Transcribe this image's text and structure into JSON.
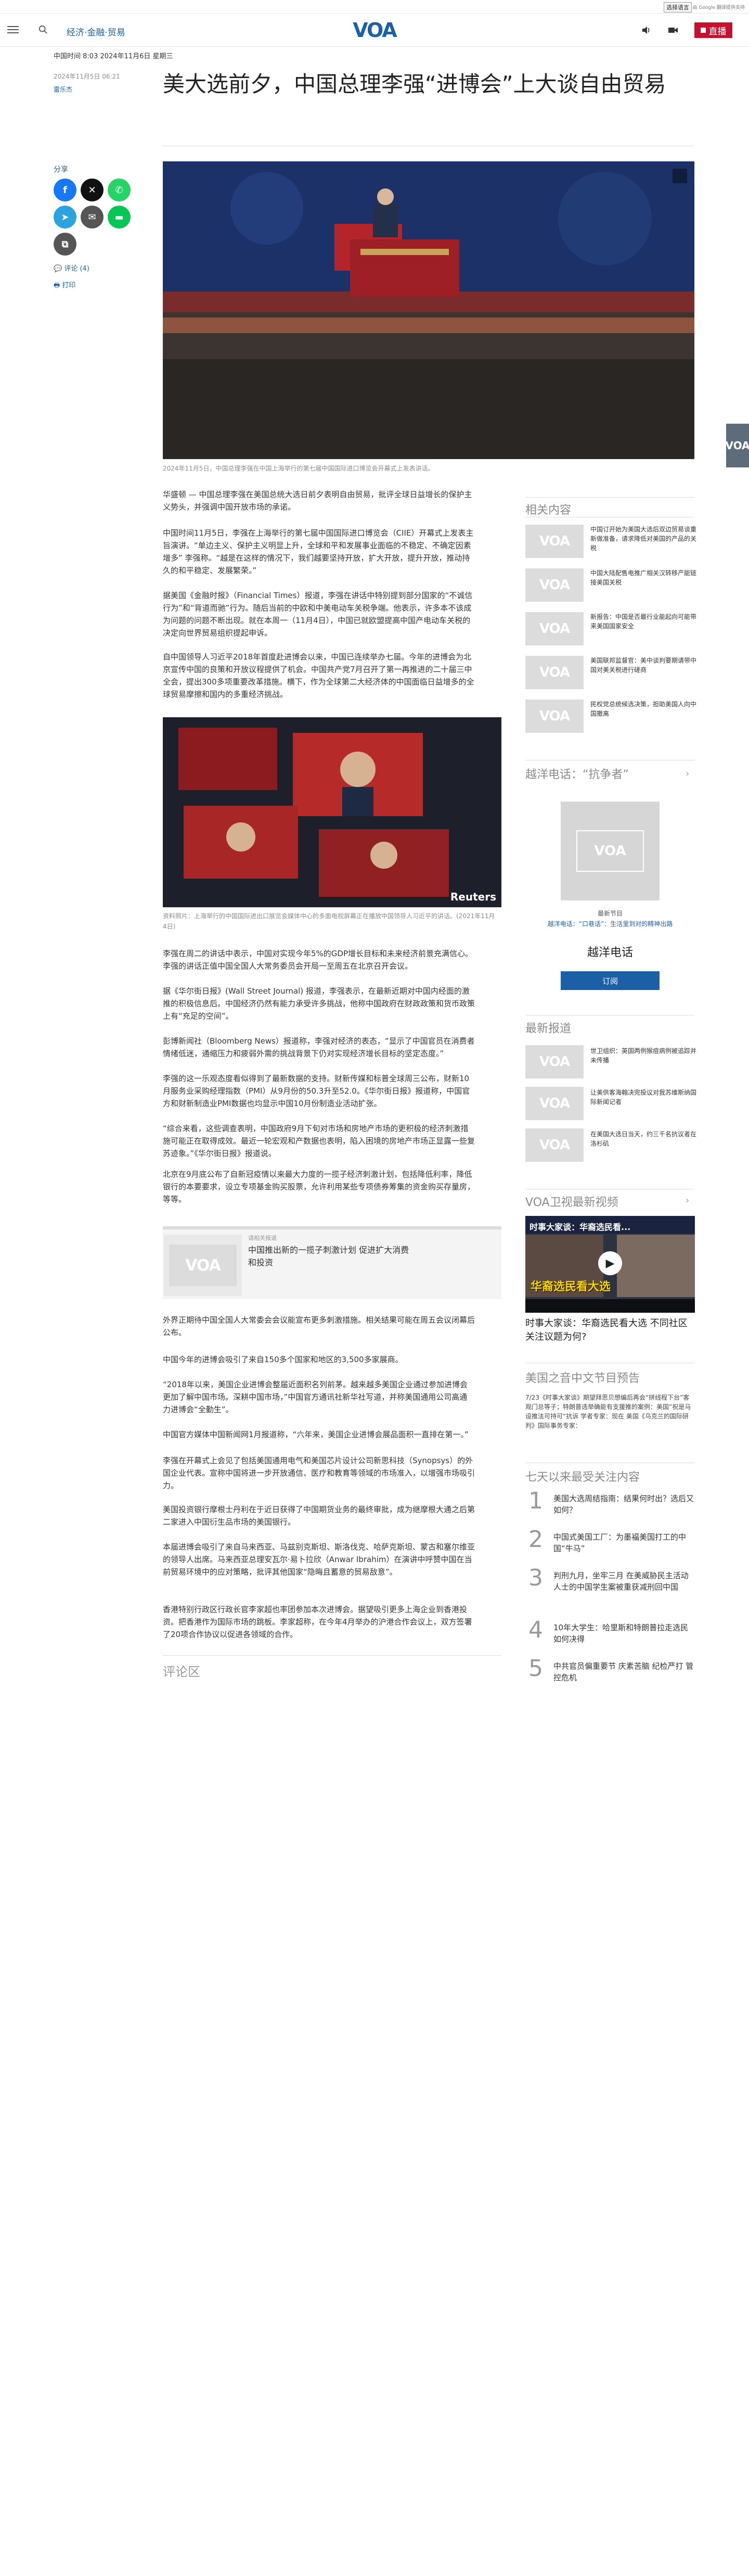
{
  "utility": {
    "language_select": "选择语言",
    "google_translate": "由 Google 翻译提供支持"
  },
  "header": {
    "section_link": "经济·金融·贸易",
    "logo": "VOA",
    "live_label": "直播"
  },
  "breadcrumb": {
    "prefix": "中国时间",
    "time": "8:03 2024年11月6日 星期三"
  },
  "article": {
    "date": "2024年11月5日 06:21",
    "author": "雷乐杰",
    "title": "美大选前夕，中国总理李强“进博会”上大谈自由贸易",
    "share_label": "分享",
    "comments_link": "评论 (4)",
    "print_link": "打印",
    "hero_caption": "2024年11月5日，中国总理李强在中国上海举行的第七届中国国际进口博览会开幕式上发表讲话。",
    "inline_caption": "资料照片：上海举行的中国国际进出口展览会媒体中心的多面电视屏幕正在播放中国领导人习近平的讲话。(2021年11月4日)",
    "paragraphs": [
      "华盛顿 — 中国总理李强在美国总统大选日前夕表明自由贸易，批评全球日益增长的保护主义势头，并强调中国开放市场的承诺。",
      "中国时间11月5日，李强在上海举行的第七届中国国际进口博览会（CIIE）开幕式上发表主旨演讲。“单边主义、保护主义明显上升，全球和平和发展事业面临的不稳定、不确定因素增多” 李强称。“越是在这样的情况下，我们越要坚持开放，扩大开放，提升开放，推动持久的和平稳定、发展繁荣。”",
      "据美国《金融时报》（Financial Times）报道，李强在讲话中特别提到部分国家的“不诚信行为”和“背道而驰”行为。随后当前的中欧和中美电动车关税争端。他表示，许多本不该成为问题的问题不断出现。就在本周一（11月4日），中国已就欧盟提高中国产电动车关税的决定向世界贸易组织提起申诉。",
      "自中国领导人习近平2018年首度赴进博会以来，中国已连续举办七届。今年的进博会为北京宣传中国的良策和开放议程提供了机会。中国共产党7月召开了第一再推进的二十届三中全会，提出300多项重要改革措施。横下，作为全球第二大经济体的中国面临日益增多的全球贸易摩擦和国内的多重经济挑战。",
      "李强在周二的讲话中表示，中国对实现今年5%的GDP增长目标和未来经济前景充满信心。李强的讲话正值中国全国人大常务委员会开局一至周五在北京召开会议。",
      "据《华尔街日报》(Wall Street Journal) 报道，李强表示，在最新近期对中国内经面的激推的积极信息后。中国经济仍然有能力承受许多挑战，他称中国政府在财政政策和货币政策上有“充足的空间”。",
      "彭博新闻社（Bloomberg News）报道称，李强对经济的表态，“显示了中国官员在消费者情绪低迷，通缩压力和疲弱外需的挑战背景下仍对实现经济增长目标的坚定态度。”",
      "李强的这一乐观态度看似得到了最新数据的支持。财新传媒和标普全球周三公布，财新10月服务业采购经理指数（PMI）从9月份的50.3升至52.0。《华尔街日报》报道称，中国官方和财新制造业PMI数据也均显示中国10月份制造业活动扩张。",
      "“综合来看，这些调查表明，中国政府9月下旬对市场和房地产市场的更积极的经济刺激措施可能正在取得成效。最近一轮宏观和产数据也表明，陷入困境的房地产市场正显露一些复苏迹象。”《华尔街日报》报道说。",
      "北京在9月底公布了自新冠疫情以来最大力度的一揽子经济刺激计划，包括降低利率，降低银行的本要要求，设立专项基金购买股票，允许利用某些专项债券筹集的资金购买存量房，等等。"
    ],
    "related_box": {
      "label": "请相关报道",
      "title": "中国推出新的一揽子刺激计划 促进扩大消费和投资"
    },
    "paragraphs_2": [
      "外界正期待中国全国人大常委会会议能宣布更多刺激措施。相关结果可能在周五会议闭幕后公布。",
      "中国今年的进博会吸引了来自150多个国家和地区的3,500多家展商。",
      "“2018年以来，美国企业进博会整届近面积名列前茅。越来越多美国企业通过参加进博会更加了解中国市场。深耕中国市场，”中国官方通讯社新华社写道，并称美国通用公司高通力进博会“全勤生”。",
      "中国官方媒体中国新闻网1月报道称，“六年来，美国企业进博会展品面积一直排在第一。”",
      "李强在开幕式上会见了包括美国通用电气和美国芯片设计公司新思科技（Synopsys）的外国企业代表。宣称中国将进一步开放通信、医疗和教育等领域的市场准入，以增强市场吸引力。",
      "美国投资银行摩根士丹利在于近日获得了中国期货业务的最终审批，成为继摩根大通之后第二家进入中国衍生品市场的美国银行。",
      "本届进博会吸引了来自马来西亚、马兹别克斯坦、斯洛伐克、哈萨克斯坦、蒙古和塞尔维亚的领导人出席。马来西亚总理安瓦尔·易卜拉欣（Anwar Ibrahim）在演讲中呼赞中国在当前贸易环境中的应对策略，批评其他国家“隐晦且蓄意的贸易敌意”。",
      "香港特别行政区行政长官李家超也率团参加本次进博会。据望吸引更多上海企业到香港投资。把香港作为国际市场的跳板。李家超称，在今年4月举办的沪港合作会议上，双方签署了20项合作协议以促进各领域的合作。"
    ],
    "comments_heading": "评论区"
  },
  "sidebar": {
    "related_heading": "相关内容",
    "related_items": [
      "中国订开始为美国大选后双边贸易谈重新做准备，请求降低对美国的产品的关税",
      "中国大陆配售电推广相关汉转移产能链接美国关税",
      "新报告：中国是否最行业能起向可能带来美国国家安全",
      "美国联邦监督官：美中谈判要期请带中国对美关税进行磋商",
      "民权党总统候选决策，担助美国人向中国撤离"
    ],
    "radio_heading": "越洋电话：“抗争者”",
    "radio_latest": "最新节目",
    "radio_episode": "越洋电话：“口巷话”：生活里到对的精神出路",
    "radio_title": "越洋电话",
    "subscribe": "订阅",
    "latest_heading": "最新报道",
    "latest_items": [
      "世卫组织：英国两例猴痘病例被追踪并未传播",
      "让美供客海翰决完投议对我苏维斯纳国际新闻记者",
      "在美国大选日当天，约三千名抗议者在洛杉矶"
    ],
    "video_heading": "VOA卫视最新视频",
    "video_banner": "时事大家谈：华裔选民看...",
    "video_overlay": "华裔选民看大选",
    "video_caption": "时事大家谈：华裔选民看大选 不同社区关注议题为何?",
    "podcast_heading": "美国之音中文节目预告",
    "podcast_text": "7/23《时事大家谈》期望拜思贝想编后再会“拼线程下台”客观门总等子；特朗普选举确能有支援推的案例：美国”祝是马设推法可持可“抗诉 学者专家：现在 美国《乌克兰的国际研判》国际事务专家：",
    "popular_heading": "七天以来最受关注内容",
    "popular": [
      "美国大选周结指南：结果何时出？选后又如何？",
      "中国式美国工厂：为墨福美国打工的中国“牛马”",
      "判刑九月，坐牢三月 在美威胁民主活动人士的中国学生案被重获减刑回中国",
      "10年大学生：哈里斯和特朗普拉走选民如何决得",
      "中共官员偏重要节 庆素苦脑 纪检严打 管控危机"
    ]
  }
}
